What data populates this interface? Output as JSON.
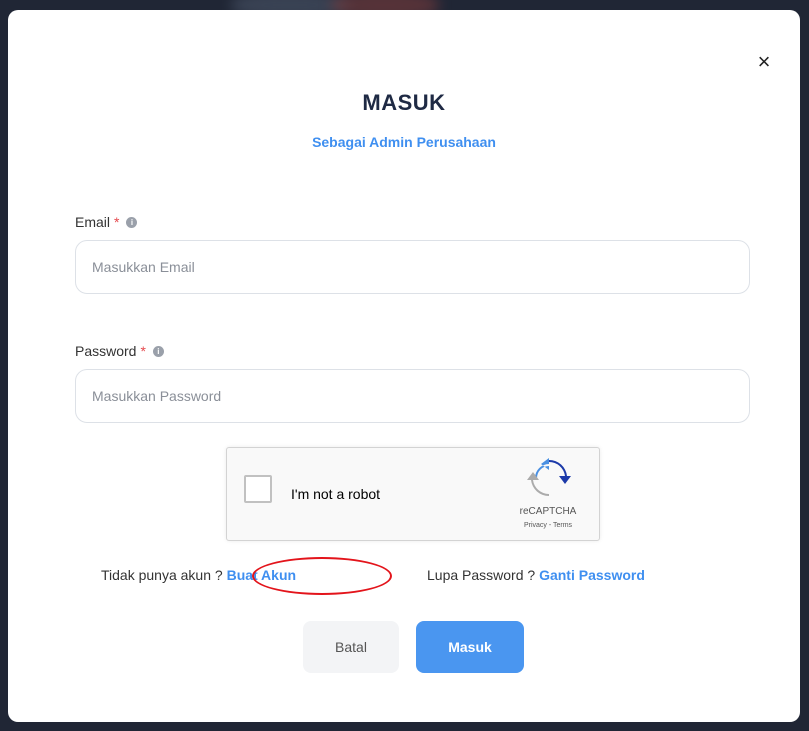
{
  "modal": {
    "title": "MASUK",
    "subtitle": "Sebagai Admin Perusahaan",
    "close_symbol": "×"
  },
  "form": {
    "email": {
      "label": "Email",
      "required_mark": "*",
      "placeholder": "Masukkan Email",
      "value": ""
    },
    "password": {
      "label": "Password",
      "required_mark": "*",
      "placeholder": "Masukkan Password",
      "value": ""
    }
  },
  "recaptcha": {
    "text": "I'm not a robot",
    "brand": "reCAPTCHA",
    "terms": "Privacy - Terms"
  },
  "links": {
    "no_account_text": "Tidak punya akun ?",
    "create_account": "Buat Akun",
    "forgot_text": "Lupa Password ?",
    "change_password": "Ganti Password"
  },
  "buttons": {
    "cancel": "Batal",
    "submit": "Masuk"
  },
  "icons": {
    "close": "close-icon",
    "info": "info-icon",
    "recaptcha": "recaptcha-logo-icon"
  },
  "colors": {
    "accent": "#3f8ff0",
    "submit_bg": "#4a96f0",
    "required": "#e5484d",
    "annotation": "#e3141b"
  }
}
